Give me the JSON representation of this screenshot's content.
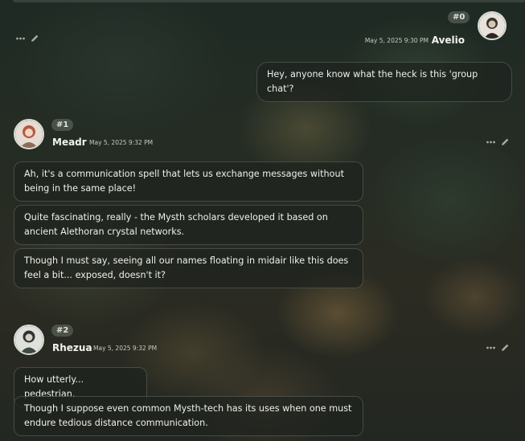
{
  "messages": [
    {
      "id_label": "#0",
      "author": "Avelio",
      "timestamp": "May 5, 2025 9:30 PM",
      "bubbles": [
        "Hey, anyone know what the heck is this 'group chat'?"
      ]
    },
    {
      "id_label": "#1",
      "author": "Meadr",
      "timestamp": "May 5, 2025 9:32 PM",
      "bubbles": [
        "Ah, it's a communication spell that lets us exchange messages without being in the same place!",
        "Quite fascinating, really - the Mysth scholars developed it based on ancient Alethoran crystal networks.",
        "Though I must say, seeing all our names floating in midair like this does feel a bit... exposed, doesn't it?"
      ]
    },
    {
      "id_label": "#2",
      "author": "Rhezua",
      "timestamp": "May 5, 2025 9:32 PM",
      "bubbles": [
        "How utterly... pedestrian.",
        "Though I suppose even common Mysth-tech has its uses when one must endure tedious distance communication."
      ]
    }
  ],
  "icons": {
    "more": "more-dots-icon",
    "edit": "pencil-icon"
  },
  "colors": {
    "accent_text": "#eef1ea",
    "badge": "#78807a"
  }
}
